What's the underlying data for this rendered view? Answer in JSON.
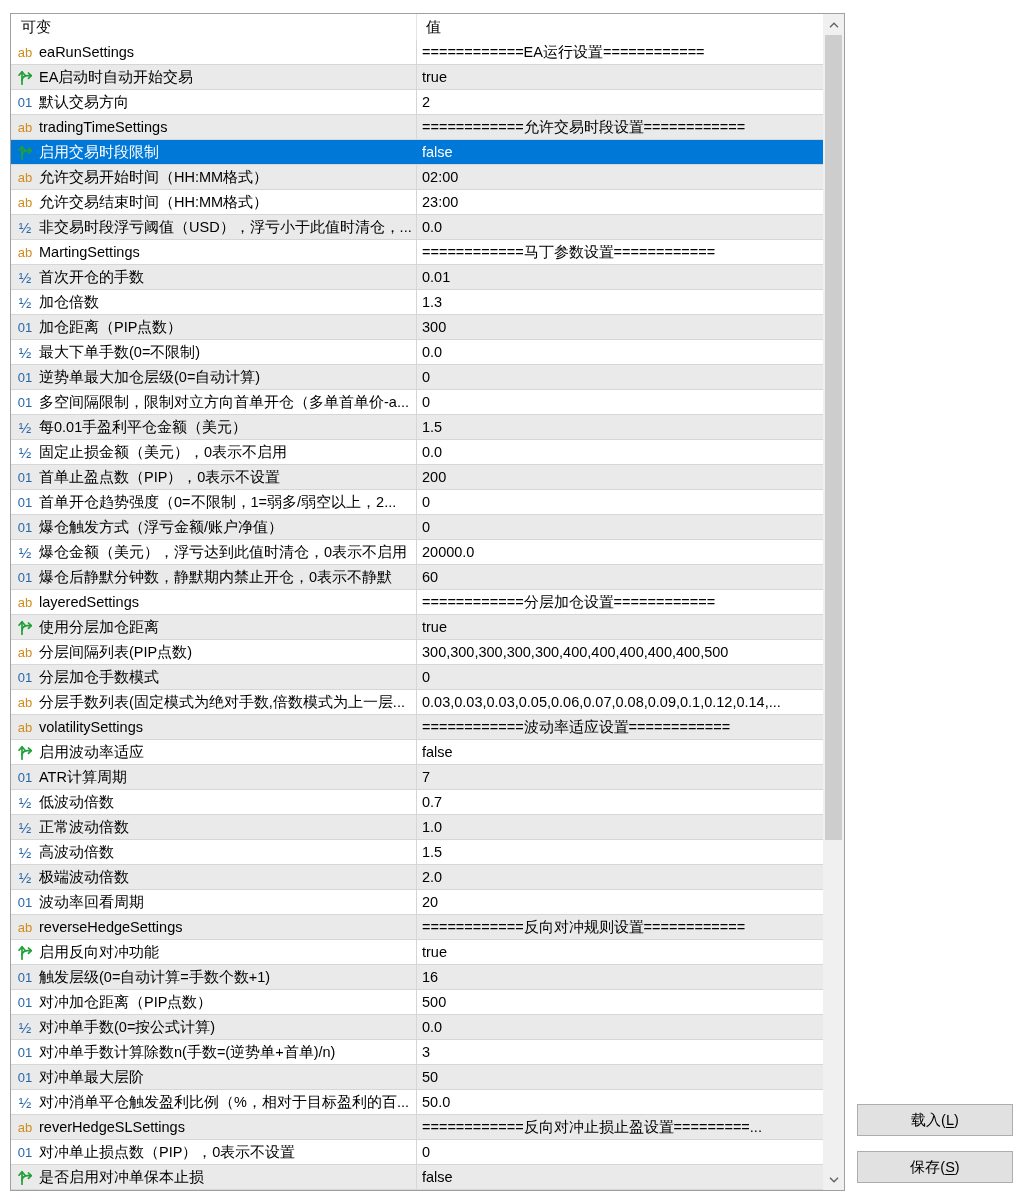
{
  "columns": [
    "可变",
    "值"
  ],
  "parameters": [
    {
      "kind": "string",
      "type_mark": "ab",
      "name": "eaRunSettings",
      "value": "============EA运行设置============",
      "selected": false
    },
    {
      "kind": "bool",
      "name": "EA启动时自动开始交易",
      "value": "true",
      "selected": false
    },
    {
      "kind": "int",
      "type_mark": "01",
      "name": "默认交易方向",
      "value": "2",
      "selected": false
    },
    {
      "kind": "string",
      "type_mark": "ab",
      "name": "tradingTimeSettings",
      "value": "============允许交易时段设置============",
      "selected": false
    },
    {
      "kind": "bool",
      "name": "启用交易时段限制",
      "value": "false",
      "selected": true
    },
    {
      "kind": "string",
      "type_mark": "ab",
      "name": "允许交易开始时间（HH:MM格式）",
      "value": "02:00",
      "selected": false
    },
    {
      "kind": "string",
      "type_mark": "ab",
      "name": "允许交易结束时间（HH:MM格式）",
      "value": "23:00",
      "selected": false
    },
    {
      "kind": "double",
      "type_mark": "½",
      "name": "非交易时段浮亏阈值（USD），浮亏小于此值时清仓，...",
      "value": "0.0",
      "selected": false
    },
    {
      "kind": "string",
      "type_mark": "ab",
      "name": "MartingSettings",
      "value": "============马丁参数设置============",
      "selected": false
    },
    {
      "kind": "double",
      "type_mark": "½",
      "name": "首次开仓的手数",
      "value": "0.01",
      "selected": false
    },
    {
      "kind": "double",
      "type_mark": "½",
      "name": "加仓倍数",
      "value": "1.3",
      "selected": false
    },
    {
      "kind": "int",
      "type_mark": "01",
      "name": "加仓距离（PIP点数）",
      "value": "300",
      "selected": false
    },
    {
      "kind": "double",
      "type_mark": "½",
      "name": "最大下单手数(0=不限制)",
      "value": "0.0",
      "selected": false
    },
    {
      "kind": "int",
      "type_mark": "01",
      "name": "逆势单最大加仓层级(0=自动计算)",
      "value": "0",
      "selected": false
    },
    {
      "kind": "int",
      "type_mark": "01",
      "name": "多空间隔限制，限制对立方向首单开仓（多单首单价-a...",
      "value": "0",
      "selected": false
    },
    {
      "kind": "double",
      "type_mark": "½",
      "name": "每0.01手盈利平仓金额（美元）",
      "value": "1.5",
      "selected": false
    },
    {
      "kind": "double",
      "type_mark": "½",
      "name": "固定止损金额（美元），0表示不启用",
      "value": "0.0",
      "selected": false
    },
    {
      "kind": "int",
      "type_mark": "01",
      "name": "首单止盈点数（PIP），0表示不设置",
      "value": "200",
      "selected": false
    },
    {
      "kind": "int",
      "type_mark": "01",
      "name": "首单开仓趋势强度（0=不限制，1=弱多/弱空以上，2...",
      "value": "0",
      "selected": false
    },
    {
      "kind": "int",
      "type_mark": "01",
      "name": "爆仓触发方式（浮亏金额/账户净值）",
      "value": "0",
      "selected": false
    },
    {
      "kind": "double",
      "type_mark": "½",
      "name": "爆仓金额（美元），浮亏达到此值时清仓，0表示不启用",
      "value": "20000.0",
      "selected": false
    },
    {
      "kind": "int",
      "type_mark": "01",
      "name": "爆仓后静默分钟数，静默期内禁止开仓，0表示不静默",
      "value": "60",
      "selected": false
    },
    {
      "kind": "string",
      "type_mark": "ab",
      "name": "layeredSettings",
      "value": "============分层加仓设置============",
      "selected": false
    },
    {
      "kind": "bool",
      "name": "使用分层加仓距离",
      "value": "true",
      "selected": false
    },
    {
      "kind": "string",
      "type_mark": "ab",
      "name": "分层间隔列表(PIP点数)",
      "value": "300,300,300,300,300,400,400,400,400,400,500",
      "selected": false
    },
    {
      "kind": "int",
      "type_mark": "01",
      "name": "分层加仓手数模式",
      "value": "0",
      "selected": false
    },
    {
      "kind": "string",
      "type_mark": "ab",
      "name": "分层手数列表(固定模式为绝对手数,倍数模式为上一层...",
      "value": "0.03,0.03,0.03,0.05,0.06,0.07,0.08,0.09,0.1,0.12,0.14,...",
      "selected": false
    },
    {
      "kind": "string",
      "type_mark": "ab",
      "name": "volatilitySettings",
      "value": "============波动率适应设置============",
      "selected": false
    },
    {
      "kind": "bool",
      "name": "启用波动率适应",
      "value": "false",
      "selected": false
    },
    {
      "kind": "int",
      "type_mark": "01",
      "name": "ATR计算周期",
      "value": "7",
      "selected": false
    },
    {
      "kind": "double",
      "type_mark": "½",
      "name": "低波动倍数",
      "value": "0.7",
      "selected": false
    },
    {
      "kind": "double",
      "type_mark": "½",
      "name": "正常波动倍数",
      "value": "1.0",
      "selected": false
    },
    {
      "kind": "double",
      "type_mark": "½",
      "name": "高波动倍数",
      "value": "1.5",
      "selected": false
    },
    {
      "kind": "double",
      "type_mark": "½",
      "name": "极端波动倍数",
      "value": "2.0",
      "selected": false
    },
    {
      "kind": "int",
      "type_mark": "01",
      "name": "波动率回看周期",
      "value": "20",
      "selected": false
    },
    {
      "kind": "string",
      "type_mark": "ab",
      "name": "reverseHedgeSettings",
      "value": "============反向对冲规则设置============",
      "selected": false
    },
    {
      "kind": "bool",
      "name": "启用反向对冲功能",
      "value": "true",
      "selected": false
    },
    {
      "kind": "int",
      "type_mark": "01",
      "name": "触发层级(0=自动计算=手数个数+1)",
      "value": "16",
      "selected": false
    },
    {
      "kind": "int",
      "type_mark": "01",
      "name": "对冲加仓距离（PIP点数）",
      "value": "500",
      "selected": false
    },
    {
      "kind": "double",
      "type_mark": "½",
      "name": "对冲单手数(0=按公式计算)",
      "value": "0.0",
      "selected": false
    },
    {
      "kind": "int",
      "type_mark": "01",
      "name": "对冲单手数计算除数n(手数=(逆势单+首单)/n)",
      "value": "3",
      "selected": false
    },
    {
      "kind": "int",
      "type_mark": "01",
      "name": "对冲单最大层阶",
      "value": "50",
      "selected": false
    },
    {
      "kind": "double",
      "type_mark": "½",
      "name": "对冲消单平仓触发盈利比例（%，相对于目标盈利的百...",
      "value": "50.0",
      "selected": false
    },
    {
      "kind": "string",
      "type_mark": "ab",
      "name": "reverHedgeSLSettings",
      "value": "============反向对冲止损止盈设置=========...",
      "selected": false
    },
    {
      "kind": "int",
      "type_mark": "01",
      "name": "对冲单止损点数（PIP），0表示不设置",
      "value": "0",
      "selected": false
    },
    {
      "kind": "bool",
      "name": "是否启用对冲单保本止损",
      "value": "false",
      "selected": false
    }
  ],
  "buttons": [
    {
      "label": "载入(L)",
      "mnemonic_underlined": true
    },
    {
      "label": "保存(S)",
      "mnemonic_underlined": true
    }
  ]
}
